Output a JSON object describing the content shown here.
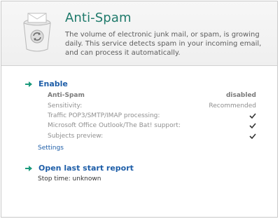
{
  "header": {
    "title": "Anti-Spam",
    "description": "The volume of electronic junk mail, or spam, is growing daily. This service detects spam in your incoming email, and can process it automatically.",
    "logo_icon": "mail-trash-icon"
  },
  "enable_section": {
    "title": "Enable",
    "rows": [
      {
        "label": "Anti-Spam",
        "value": "disabled",
        "emphasis": true
      },
      {
        "label": "Sensitivity:",
        "value": "Recommended",
        "emphasis": false
      },
      {
        "label": "Traffic POP3/SMTP/IMAP processing:",
        "value": "",
        "check": true
      },
      {
        "label": "Microsoft Office Outlook/The Bat! support:",
        "value": "",
        "check": true
      },
      {
        "label": "Subjects preview:",
        "value": "",
        "check": true
      }
    ],
    "settings_link": "Settings"
  },
  "report_section": {
    "title": "Open last start report",
    "stop_time": "Stop time: unknown"
  },
  "colors": {
    "accent": "#1f7a6b",
    "link": "#1e5ea8",
    "arrow": "#1b9a7c"
  }
}
